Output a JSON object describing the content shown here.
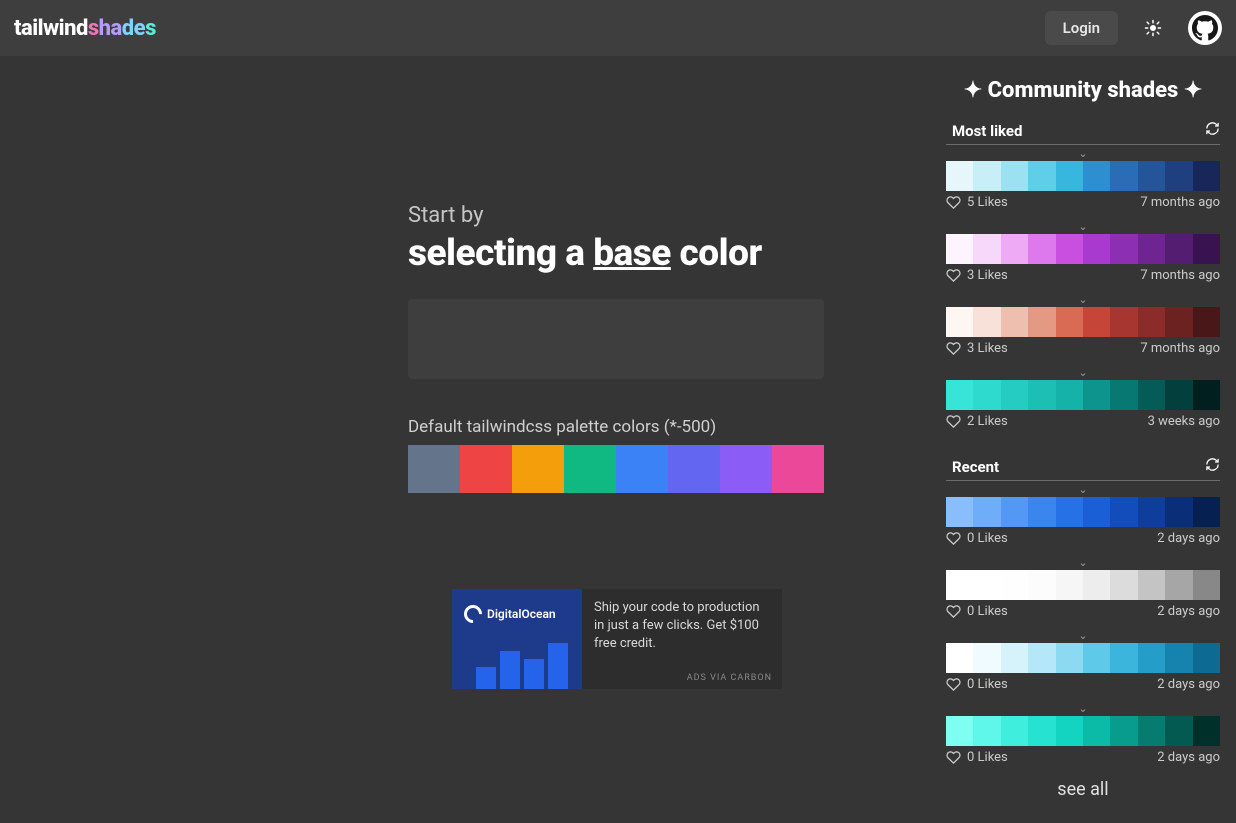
{
  "header": {
    "logo": {
      "p1": "tailwind",
      "p2": "s",
      "p3": "ha",
      "p4": "de",
      "p5": "s"
    },
    "login_label": "Login"
  },
  "main": {
    "intro_small": "Start by",
    "intro_big_1": "selecting a ",
    "intro_big_underline": "base",
    "intro_big_2": " color",
    "palette_label": "Default tailwindcss palette colors (*-500)",
    "default_palette": [
      "#64748b",
      "#ef4444",
      "#f59e0b",
      "#10b981",
      "#3b82f6",
      "#6366f1",
      "#8b5cf6",
      "#ec4899"
    ]
  },
  "ad": {
    "brand": "DigitalOcean",
    "text": "Ship your code to production in just a few clicks. Get $100 free credit.",
    "via": "ADS VIA CARBON"
  },
  "community": {
    "title": "✦ Community shades ✦",
    "most_liked_label": "Most liked",
    "recent_label": "Recent",
    "see_all": "see all",
    "most_liked": [
      {
        "likes": "5 Likes",
        "time": "7 months ago",
        "colors": [
          "#e6f7fb",
          "#c8eef7",
          "#9ce1f1",
          "#5fcfe9",
          "#37b6de",
          "#2e8fd0",
          "#2a6cb6",
          "#24549a",
          "#1f3f7e",
          "#18275a"
        ]
      },
      {
        "likes": "3 Likes",
        "time": "7 months ago",
        "colors": [
          "#fdf4ff",
          "#f7d8fb",
          "#eeaaf5",
          "#de78ed",
          "#c84fe0",
          "#a83ad0",
          "#8c2fb2",
          "#6f2591",
          "#541d72",
          "#381350"
        ]
      },
      {
        "likes": "3 Likes",
        "time": "7 months ago",
        "colors": [
          "#fdf6f3",
          "#f7e1d9",
          "#eebeae",
          "#e49984",
          "#d96b55",
          "#c54638",
          "#a83630",
          "#8a2c29",
          "#6b2221",
          "#4a1718"
        ]
      },
      {
        "likes": "2 Likes",
        "time": "3 weeks ago",
        "colors": [
          "#37e5d8",
          "#2ed9cd",
          "#25ccc1",
          "#1cbfb4",
          "#14b2a8",
          "#0d958d",
          "#087872",
          "#055c57",
          "#033f3c",
          "#011f1e"
        ]
      }
    ],
    "recent": [
      {
        "likes": "0 Likes",
        "time": "2 days ago",
        "colors": [
          "#8abdfb",
          "#6fadf9",
          "#5398f4",
          "#3a85ee",
          "#2671e6",
          "#1a5fd6",
          "#134dbc",
          "#0e3d9b",
          "#0a2e78",
          "#062052"
        ]
      },
      {
        "likes": "0 Likes",
        "time": "2 days ago",
        "colors": [
          "#ffffff",
          "#ffffff",
          "#fefefe",
          "#fcfcfc",
          "#f6f6f6",
          "#ededed",
          "#dcdcdc",
          "#c4c4c4",
          "#a6a6a6",
          "#888888"
        ]
      },
      {
        "likes": "0 Likes",
        "time": "2 days ago",
        "colors": [
          "#ffffff",
          "#f0fbff",
          "#d6f3fc",
          "#b4e8f8",
          "#8bdaf2",
          "#5fc9e9",
          "#3bb5dc",
          "#249dc9",
          "#1683af",
          "#0d6a92"
        ]
      },
      {
        "likes": "0 Likes",
        "time": "2 days ago",
        "colors": [
          "#7dfff2",
          "#5ef7e9",
          "#40eedd",
          "#25e3d0",
          "#12d4c0",
          "#0bbba8",
          "#079c8c",
          "#057c6f",
          "#035a51",
          "#01302b"
        ]
      }
    ]
  }
}
